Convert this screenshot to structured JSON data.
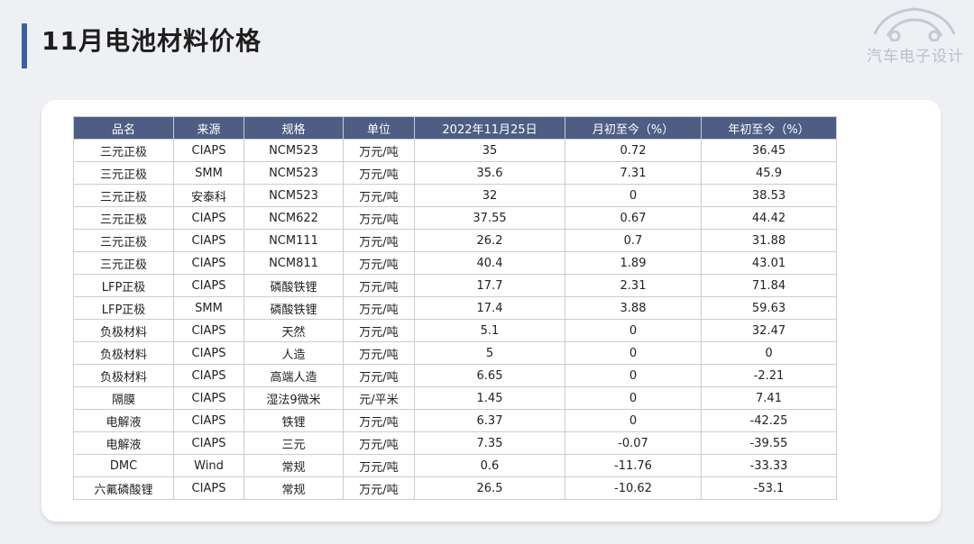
{
  "title": "11月电池材料价格",
  "logo": {
    "text": "汽车电子设计"
  },
  "colors": {
    "header_bg": "#4e5d84",
    "accent": "#3f5fa0",
    "background": "#eef0f4"
  },
  "table": {
    "headers": [
      "品名",
      "来源",
      "规格",
      "单位",
      "2022年11月25日",
      "月初至今（%）",
      "年初至今（%）"
    ],
    "rows": [
      [
        "三元正极",
        "CIAPS",
        "NCM523",
        "万元/吨",
        "35",
        "0.72",
        "36.45"
      ],
      [
        "三元正极",
        "SMM",
        "NCM523",
        "万元/吨",
        "35.6",
        "7.31",
        "45.9"
      ],
      [
        "三元正极",
        "安泰科",
        "NCM523",
        "万元/吨",
        "32",
        "0",
        "38.53"
      ],
      [
        "三元正极",
        "CIAPS",
        "NCM622",
        "万元/吨",
        "37.55",
        "0.67",
        "44.42"
      ],
      [
        "三元正极",
        "CIAPS",
        "NCM111",
        "万元/吨",
        "26.2",
        "0.7",
        "31.88"
      ],
      [
        "三元正极",
        "CIAPS",
        "NCM811",
        "万元/吨",
        "40.4",
        "1.89",
        "43.01"
      ],
      [
        "LFP正极",
        "CIAPS",
        "磷酸铁锂",
        "万元/吨",
        "17.7",
        "2.31",
        "71.84"
      ],
      [
        "LFP正极",
        "SMM",
        "磷酸铁锂",
        "万元/吨",
        "17.4",
        "3.88",
        "59.63"
      ],
      [
        "负极材料",
        "CIAPS",
        "天然",
        "万元/吨",
        "5.1",
        "0",
        "32.47"
      ],
      [
        "负极材料",
        "CIAPS",
        "人造",
        "万元/吨",
        "5",
        "0",
        "0"
      ],
      [
        "负极材料",
        "CIAPS",
        "高端人造",
        "万元/吨",
        "6.65",
        "0",
        "-2.21"
      ],
      [
        "隔膜",
        "CIAPS",
        "湿法9微米",
        "元/平米",
        "1.45",
        "0",
        "7.41"
      ],
      [
        "电解液",
        "CIAPS",
        "铁锂",
        "万元/吨",
        "6.37",
        "0",
        "-42.25"
      ],
      [
        "电解液",
        "CIAPS",
        "三元",
        "万元/吨",
        "7.35",
        "-0.07",
        "-39.55"
      ],
      [
        "DMC",
        "Wind",
        "常规",
        "万元/吨",
        "0.6",
        "-11.76",
        "-33.33"
      ],
      [
        "六氟磷酸锂",
        "CIAPS",
        "常规",
        "万元/吨",
        "26.5",
        "-10.62",
        "-53.1"
      ]
    ]
  }
}
